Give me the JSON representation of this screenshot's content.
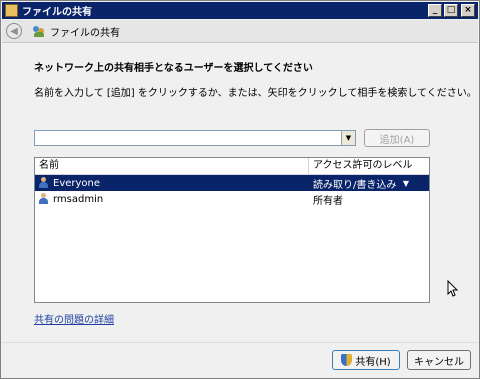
{
  "window": {
    "title": "ファイルの共有",
    "minimize": "_",
    "maximize": "□",
    "close": "×"
  },
  "nav": {
    "back": "◀",
    "title": "ファイルの共有"
  },
  "heading": "ネットワーク上の共有相手となるユーザーを選択してください",
  "instructions": "名前を入力して [追加] をクリックするか、または、矢印をクリックして相手を検索してください。",
  "combo": {
    "value": "",
    "arrow": "▼"
  },
  "add_button": "追加(A)",
  "list": {
    "headers": {
      "name": "名前",
      "access": "アクセス許可のレベル"
    },
    "rows": [
      {
        "name": "Everyone",
        "access": "読み取り/書き込み",
        "dropdown": "▼",
        "selected": true
      },
      {
        "name": "rmsadmin",
        "access": "所有者",
        "selected": false
      }
    ]
  },
  "help_link": "共有の問題の詳細",
  "buttons": {
    "share": "共有(H)",
    "cancel": "キャンセル"
  }
}
